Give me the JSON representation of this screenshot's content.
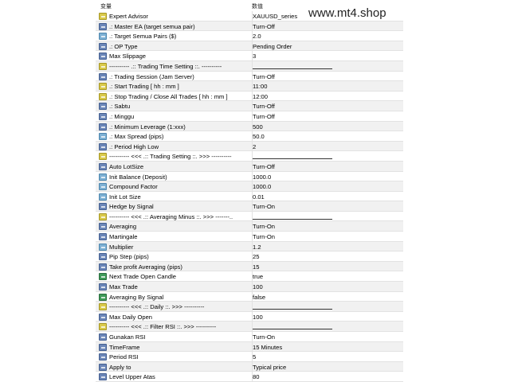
{
  "watermark": "www.mt4.shop",
  "header": {
    "col_variable": "变量",
    "col_value": "数值"
  },
  "rows": [
    {
      "icon": "ab",
      "name": "Expert Advisor",
      "value": "XAUUSD_series"
    },
    {
      "icon": "num",
      "name": ".: Master EA (target semua pair)",
      "value": "Turn-Off"
    },
    {
      "icon": "dbl",
      "name": ".: Target Semua Pairs ($)",
      "value": "2.0"
    },
    {
      "icon": "num",
      "name": ".: OP Type",
      "value": "Pending Order"
    },
    {
      "icon": "num",
      "name": "Max Slippage",
      "value": "3"
    },
    {
      "icon": "ab",
      "name": "---------- .:: Trading Time Setting ::. ----------",
      "value": "",
      "line": true
    },
    {
      "icon": "num",
      "name": ".: Trading Session (Jam Server)",
      "value": "Turn-Off"
    },
    {
      "icon": "ab",
      "name": ".: Start Trading [ hh : mm ]",
      "value": "11:00"
    },
    {
      "icon": "ab",
      "name": ".: Stop Trading / Close All Trades [ hh : mm ]",
      "value": "12:00"
    },
    {
      "icon": "num",
      "name": ".: Sabtu",
      "value": "Turn-Off"
    },
    {
      "icon": "num",
      "name": ".: Minggu",
      "value": "Turn-Off"
    },
    {
      "icon": "num",
      "name": ".: Minimum Leverage (1:xxx)",
      "value": "500"
    },
    {
      "icon": "dbl",
      "name": ".: Max Spread (pips)",
      "value": "50.0"
    },
    {
      "icon": "num",
      "name": ".: Period High Low",
      "value": "2"
    },
    {
      "icon": "ab",
      "name": "---------- <<< .:: Trading Setting ::. >>> ----------",
      "value": "",
      "line": true
    },
    {
      "icon": "num",
      "name": "Auto LotSize",
      "value": "Turn-Off"
    },
    {
      "icon": "dbl",
      "name": "Init Balance (Deposit)",
      "value": "1000.0"
    },
    {
      "icon": "dbl",
      "name": "Compound Factor",
      "value": "1000.0"
    },
    {
      "icon": "dbl",
      "name": "Init Lot Size",
      "value": "0.01"
    },
    {
      "icon": "num",
      "name": "Hedge by Signal",
      "value": "Turn-On"
    },
    {
      "icon": "ab",
      "name": "---------- <<< .:: Averaging Minus ::. >>> -------..",
      "value": "",
      "line": true
    },
    {
      "icon": "num",
      "name": "Averaging",
      "value": "Turn-On"
    },
    {
      "icon": "num",
      "name": "Martingale",
      "value": "Turn-On"
    },
    {
      "icon": "dbl",
      "name": "Multiplier",
      "value": "1.2"
    },
    {
      "icon": "num",
      "name": "Pip Step (pips)",
      "value": "25"
    },
    {
      "icon": "num",
      "name": "Take profit Averaging (pips)",
      "value": "15"
    },
    {
      "icon": "bool",
      "name": "Next Trade Open Candle",
      "value": "true"
    },
    {
      "icon": "num",
      "name": "Max Trade",
      "value": "100"
    },
    {
      "icon": "bool",
      "name": "Averaging By Signal",
      "value": "false"
    },
    {
      "icon": "ab",
      "name": "---------- <<< .:: Daily ::. >>> ----------",
      "value": "",
      "line": true
    },
    {
      "icon": "num",
      "name": "Max Daily Open",
      "value": "100"
    },
    {
      "icon": "ab",
      "name": "---------- <<< .:: Filter RSI ::. >>> ----------",
      "value": "",
      "line": true
    },
    {
      "icon": "num",
      "name": "Gunakan RSI",
      "value": "Turn-On"
    },
    {
      "icon": "num",
      "name": "TimeFrame",
      "value": "15 Minutes"
    },
    {
      "icon": "num",
      "name": "Period RSI",
      "value": "5"
    },
    {
      "icon": "num",
      "name": "Apply to",
      "value": "Typical price"
    },
    {
      "icon": "num",
      "name": "Level Upper Atas",
      "value": "80"
    }
  ]
}
